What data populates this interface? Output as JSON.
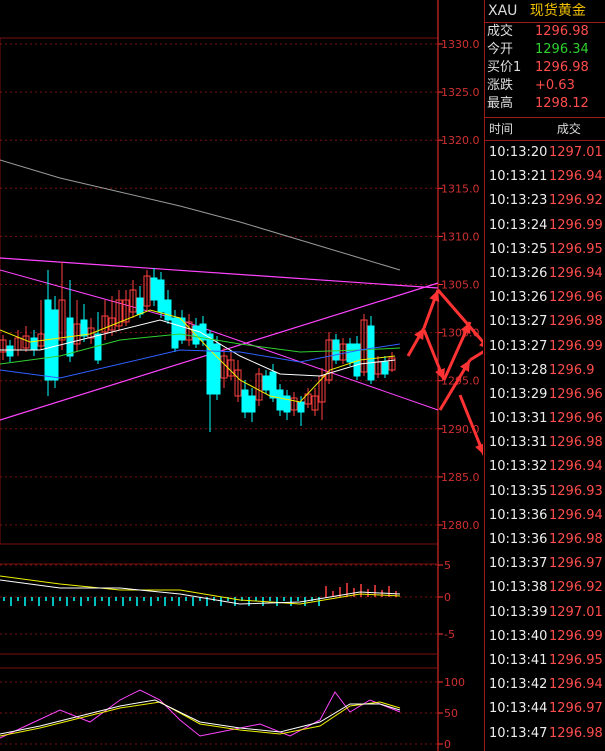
{
  "header": {
    "symbol": "XAU",
    "name": "现货黄金"
  },
  "quote": [
    {
      "label": "成交",
      "value": "1296.98",
      "color": "red"
    },
    {
      "label": "今开",
      "value": "1296.34",
      "color": "green"
    },
    {
      "label": "买价1",
      "value": "1296.98",
      "color": "red"
    },
    {
      "label": "涨跌",
      "value": "+0.63",
      "color": "red"
    },
    {
      "label": "最高",
      "value": "1298.12",
      "color": "red"
    }
  ],
  "tick_header": {
    "time": "时间",
    "price": "成交"
  },
  "ticks": [
    {
      "time": "10:13:20",
      "price": "1297.01"
    },
    {
      "time": "10:13:21",
      "price": "1296.94"
    },
    {
      "time": "10:13:23",
      "price": "1296.92"
    },
    {
      "time": "10:13:24",
      "price": "1296.99"
    },
    {
      "time": "10:13:25",
      "price": "1296.95"
    },
    {
      "time": "10:13:26",
      "price": "1296.94"
    },
    {
      "time": "10:13:26",
      "price": "1296.96"
    },
    {
      "time": "10:13:27",
      "price": "1296.98"
    },
    {
      "time": "10:13:27",
      "price": "1296.99"
    },
    {
      "time": "10:13:28",
      "price": "1296.9"
    },
    {
      "time": "10:13:29",
      "price": "1296.96"
    },
    {
      "time": "10:13:31",
      "price": "1296.96"
    },
    {
      "time": "10:13:31",
      "price": "1296.98"
    },
    {
      "time": "10:13:32",
      "price": "1296.94"
    },
    {
      "time": "10:13:35",
      "price": "1296.93"
    },
    {
      "time": "10:13:36",
      "price": "1296.94"
    },
    {
      "time": "10:13:36",
      "price": "1296.98"
    },
    {
      "time": "10:13:37",
      "price": "1296.97"
    },
    {
      "time": "10:13:38",
      "price": "1296.92"
    },
    {
      "time": "10:13:39",
      "price": "1297.01"
    },
    {
      "time": "10:13:40",
      "price": "1296.99"
    },
    {
      "time": "10:13:41",
      "price": "1296.95"
    },
    {
      "time": "10:13:42",
      "price": "1296.94"
    },
    {
      "time": "10:13:44",
      "price": "1296.97"
    },
    {
      "time": "10:13:47",
      "price": "1296.98"
    }
  ],
  "price_axis": [
    "1330.0",
    "1325.0",
    "1320.0",
    "1315.0",
    "1310.0",
    "1305.0",
    "1300.0",
    "1295.0",
    "1290.0",
    "1285.0",
    "1280.0"
  ],
  "macd_axis": [
    "5",
    "0",
    "-5"
  ],
  "kdj_axis": [
    "100",
    "50",
    "0"
  ],
  "colors": {
    "up": "#ff4040",
    "down": "#00ffff",
    "grid": "#7a1010",
    "magenta": "#ff44ff",
    "accent_red": "#ff3333"
  }
}
